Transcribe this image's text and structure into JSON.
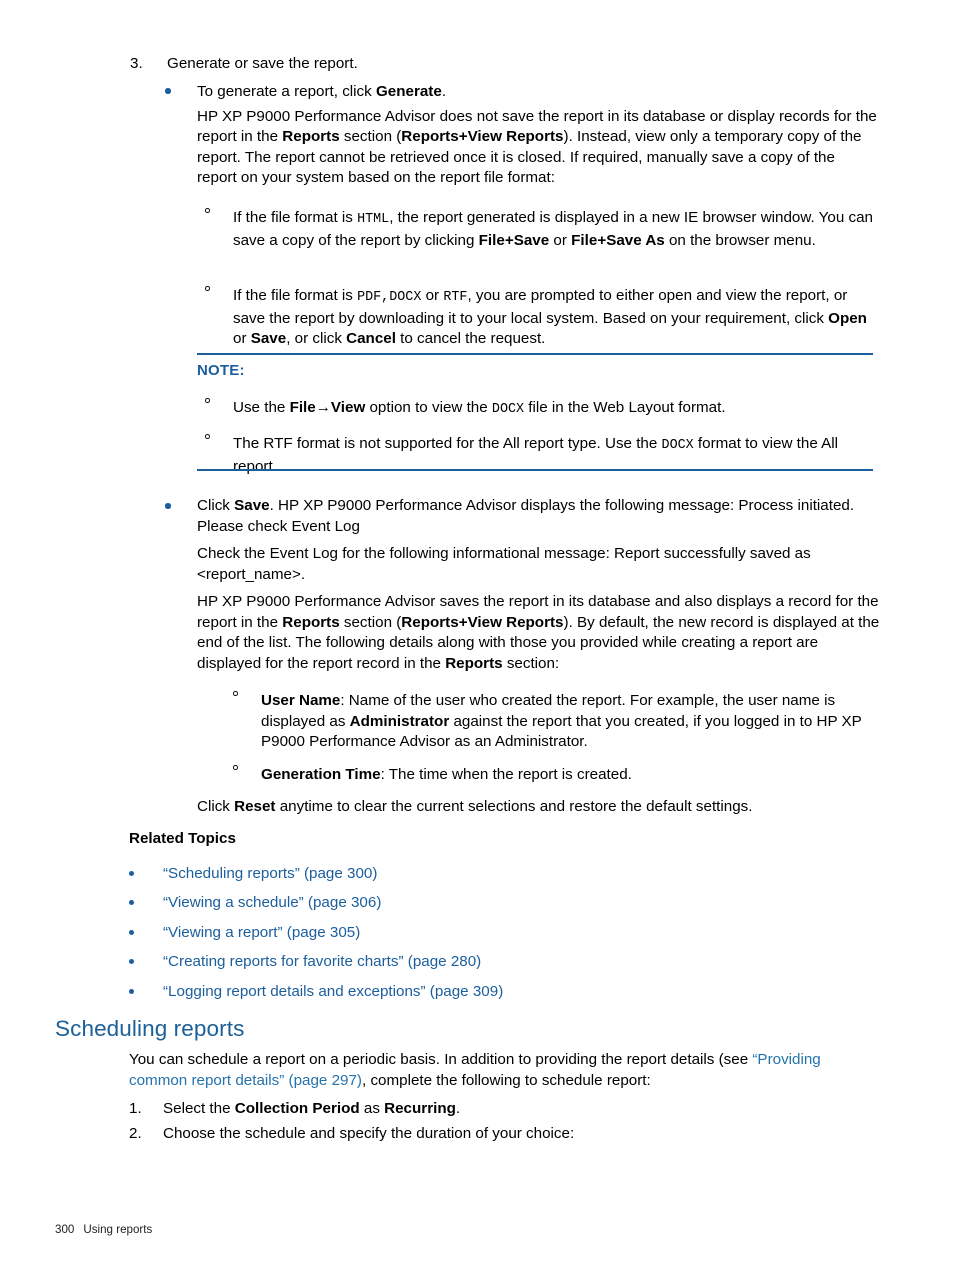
{
  "colors": {
    "link": "#1b5e9e",
    "link_light": "#2572ad",
    "heading": "#1b6098",
    "note_rule": "#1b5e9e",
    "bullet": "#1b5e9e",
    "body_text": "#000000"
  },
  "step3": {
    "number": "3.",
    "text": "Generate or save the report."
  },
  "bullet1": {
    "marker": "bullet-dot",
    "line1_pre": "To generate a report, click ",
    "line1_bold": "Generate",
    "line1_post": ".",
    "paragraph": {
      "p1": "HP XP P9000 Performance Advisor does not save the report in its database or display records for the report in the ",
      "b1": "Reports",
      "p2": " section (",
      "b2": "Reports",
      "p3": "+",
      "b3": "View Reports",
      "p4": "). Instead, view only a temporary copy of the report. The report cannot be retrieved once it is closed. If required, manually save a copy of the report on your system based on the report file format:"
    }
  },
  "sub_bullet_1": {
    "marker": "hollow-circle",
    "p1": "If the file format is ",
    "mono1": "HTML",
    "p2": ", the report generated is displayed in a new IE browser window. You can save a copy of the report by clicking ",
    "b1": "File",
    "p3": "+",
    "b2": "Save",
    "p4": " or ",
    "b3": "File",
    "p5": "+",
    "b4": "Save As",
    "p6": " on the browser menu."
  },
  "sub_bullet_2": {
    "marker": "hollow-circle",
    "p1": "If the file format is ",
    "mono1": "PDF,DOCX",
    "p2": " or ",
    "mono2": "RTF",
    "p3": ", you are prompted to either open and view the report, or save the report by downloading it to your local system. Based on your requirement, click ",
    "b1": "Open",
    "p4": " or ",
    "b2": "Save",
    "p5": ", or click ",
    "b3": "Cancel",
    "p6": " to cancel the request."
  },
  "note": {
    "title": "NOTE:",
    "item1": {
      "marker": "hollow-circle",
      "p1": "Use the ",
      "b1": "File",
      "arrow": "→",
      "b2": "View",
      "p2": " option to view the ",
      "mono1": "DOCX",
      "p3": " file in the Web Layout format."
    },
    "item2": {
      "marker": "hollow-circle",
      "p1": "The RTF format is not supported for the All report type. Use the ",
      "mono1": "DOCX",
      "p2": " format to view the All report."
    }
  },
  "bullet2": {
    "marker": "bullet-dot",
    "line1_pre": "Click ",
    "line1_bold": "Save",
    "line1_post": ". HP XP P9000 Performance Advisor displays the following message: Process initiated. Please check Event Log",
    "p2": "Check the Event Log for the following informational message: Report successfully saved as <report_name>.",
    "p3": {
      "t1": "HP XP P9000 Performance Advisor saves the report in its database and also displays a record for the report in the ",
      "b1": "Reports",
      "t2": " section (",
      "b2": "Reports",
      "t3": "+",
      "b3": "View Reports",
      "t4": "). By default, the new record is displayed at the end of the list. The following details along with those you provided while creating a report are displayed for the report record in the ",
      "b4": "Reports",
      "t5": " section:"
    }
  },
  "sub_bullet_3": {
    "marker": "hollow-circle",
    "b1": "User Name",
    "p1": ": Name of the user who created the report. For example, the user name is displayed as ",
    "b2": "Administrator",
    "p2": " against the report that you created, if you logged in to HP XP P9000 Performance Advisor as an Administrator."
  },
  "sub_bullet_4": {
    "marker": "hollow-circle",
    "b1": "Generation Time",
    "p1": ": The time when the report is created."
  },
  "reset_line": {
    "p1": "Click ",
    "b1": "Reset",
    "p2": " anytime to clear the current selections and restore the default settings."
  },
  "related_topics": {
    "title": "Related Topics",
    "items": [
      {
        "label": "“Scheduling reports” (page 300)"
      },
      {
        "label": "“Viewing a schedule” (page 306)"
      },
      {
        "label": "“Viewing a report” (page 305)"
      },
      {
        "label": "“Creating reports for favorite charts” (page 280)"
      },
      {
        "label": "“Logging report details and exceptions” (page 309)"
      }
    ]
  },
  "scheduling_section": {
    "heading": "Scheduling reports",
    "intro_p1": "You can schedule a report on a periodic basis. In addition to providing the report details (see ",
    "intro_link": "“Providing common report details” (page 297)",
    "intro_p2": ", complete the following to schedule report:",
    "steps": [
      {
        "number": "1.",
        "p1": "Select the ",
        "b1": "Collection Period",
        "p2": " as ",
        "b2": "Recurring",
        "p3": "."
      },
      {
        "number": "2.",
        "p1": "Choose the schedule and specify the duration of your choice:",
        "b1": "",
        "p2": "",
        "b2": "",
        "p3": ""
      }
    ]
  },
  "footer": {
    "page_number": "300",
    "chapter": "Using reports"
  }
}
